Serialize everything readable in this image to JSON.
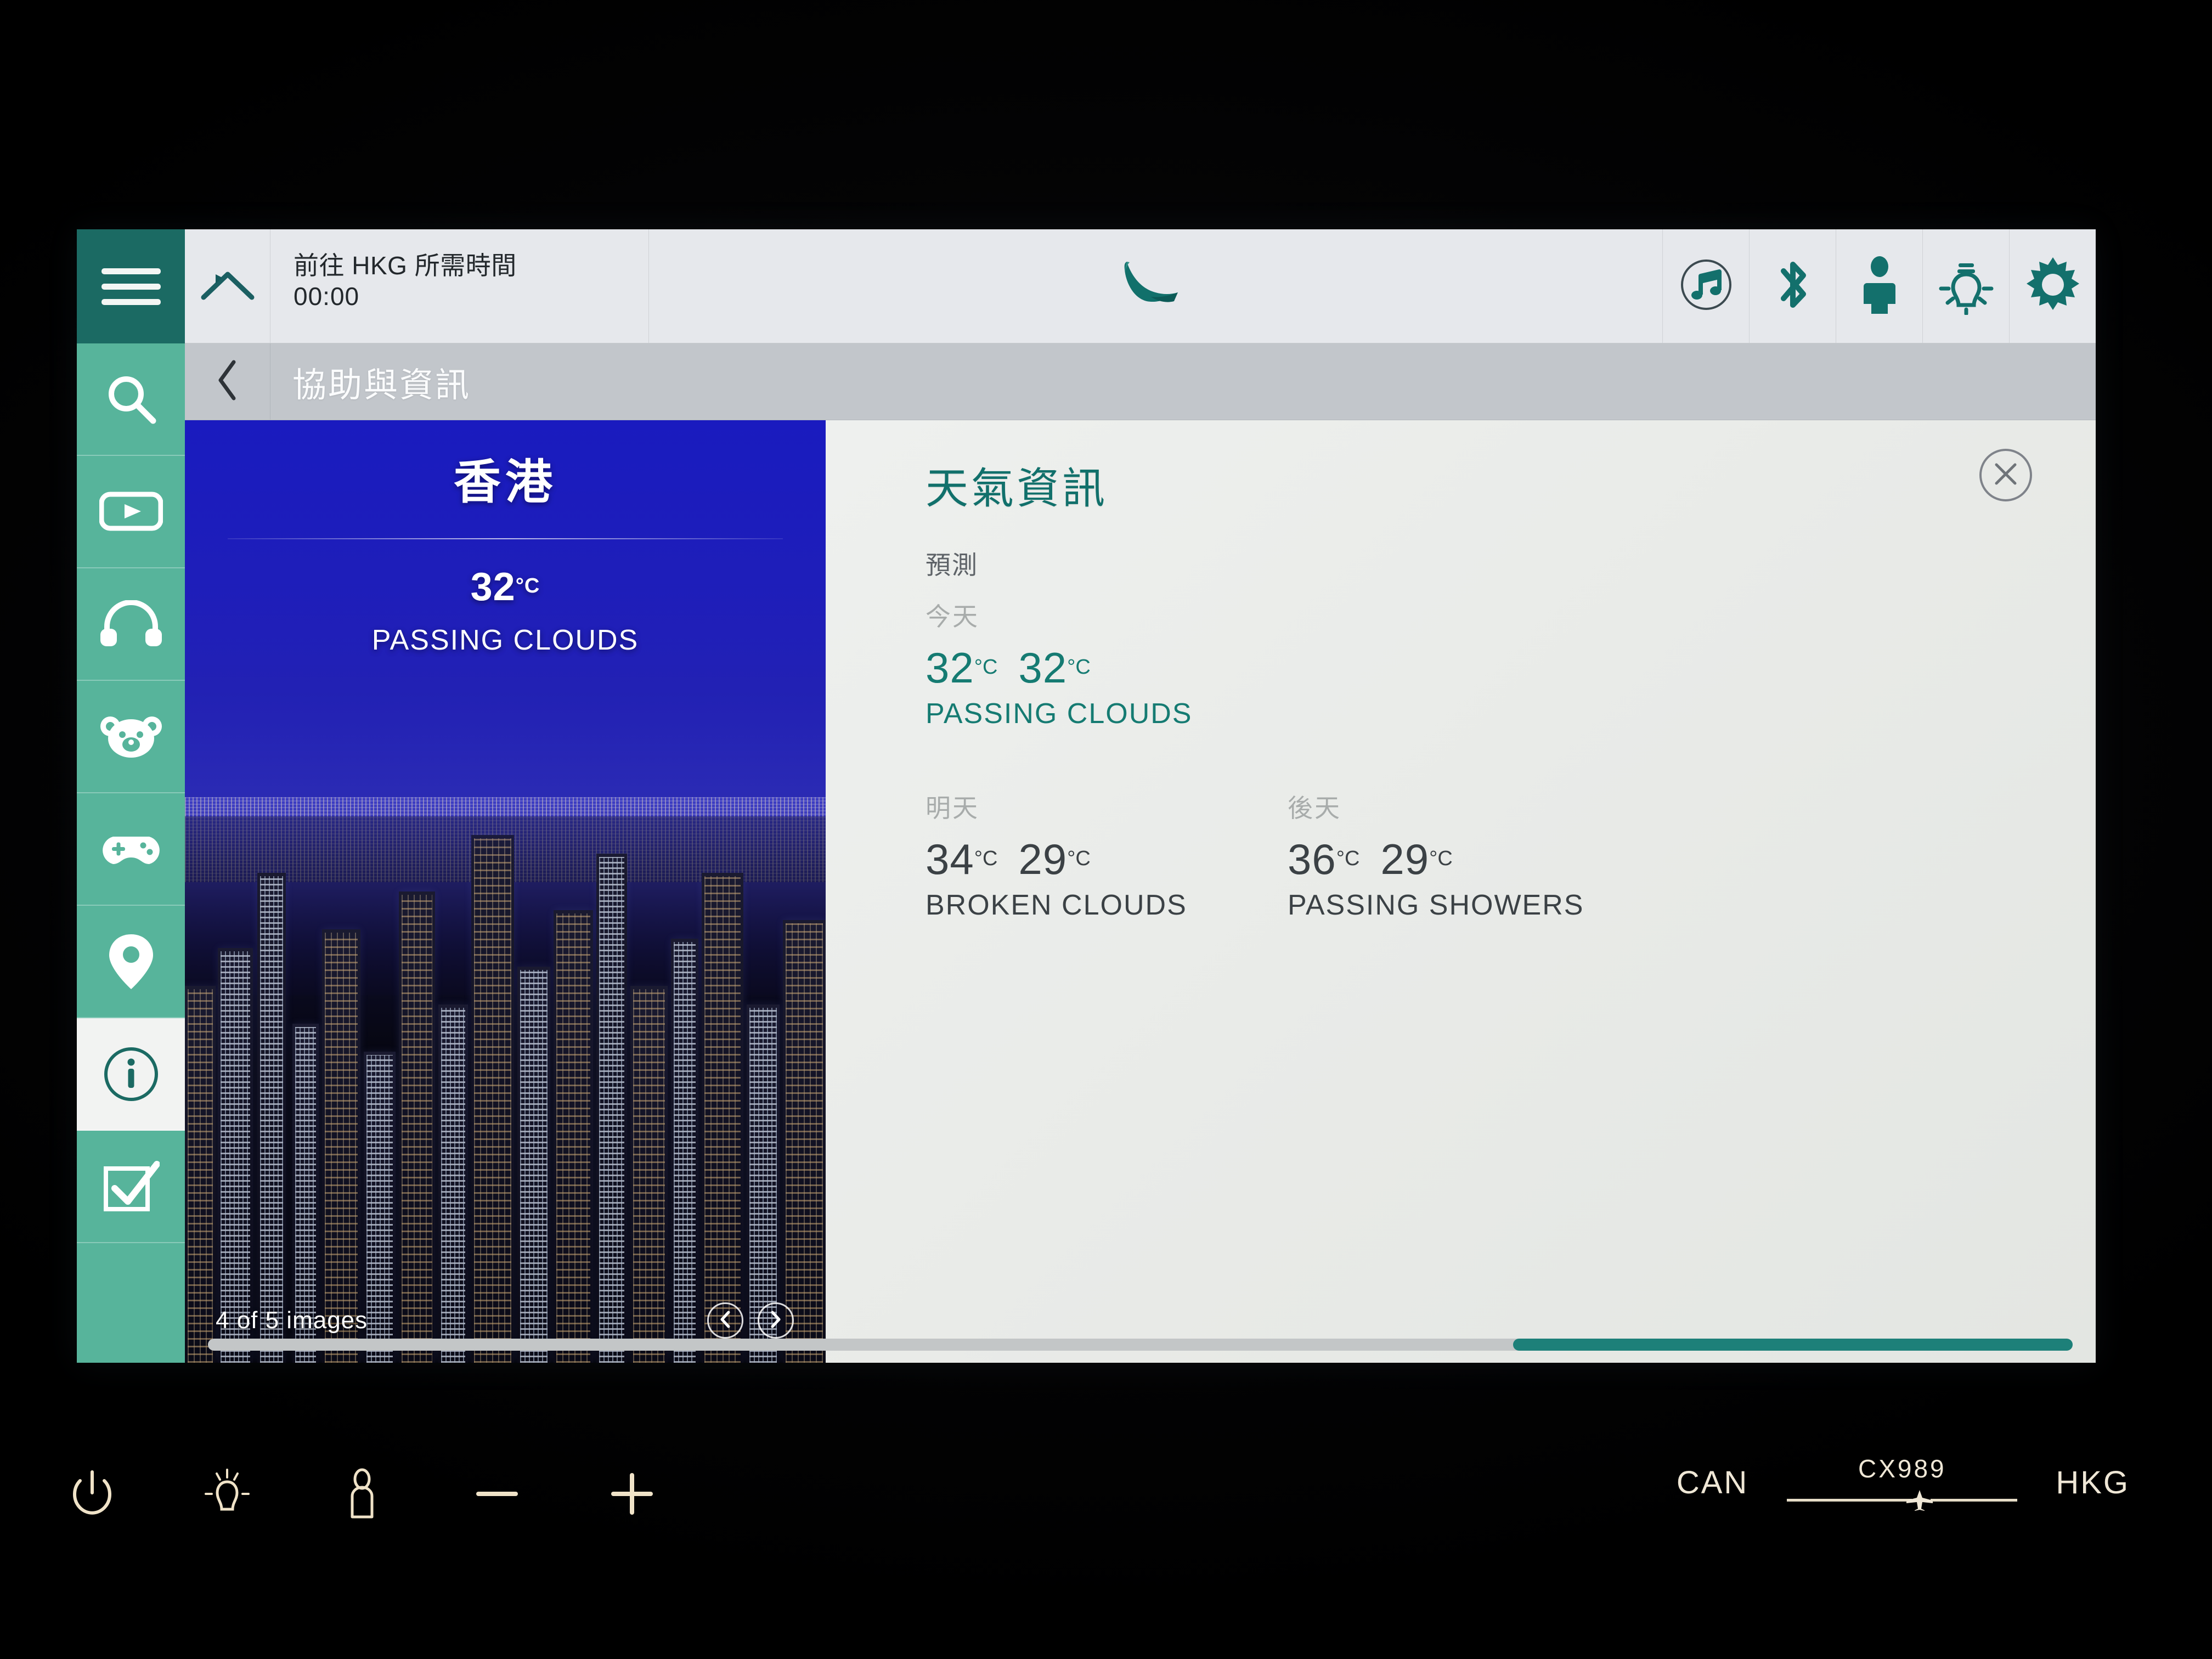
{
  "topbar": {
    "home_icon": "home-chevron-icon",
    "eta_label": "前往 HKG 所需時間",
    "eta_value": "00:00",
    "brand_logo": "cathay-brushwing-logo",
    "icons": [
      {
        "name": "music-note-icon",
        "label": "Audio playing"
      },
      {
        "name": "bluetooth-icon",
        "label": "Bluetooth"
      },
      {
        "name": "attendant-call-icon",
        "label": "Attendant call"
      },
      {
        "name": "reading-light-icon",
        "label": "Reading light"
      },
      {
        "name": "settings-gear-icon",
        "label": "Settings"
      }
    ]
  },
  "page_header": {
    "back_icon": "chevron-left-icon",
    "title": "協助與資訊"
  },
  "sidebar": {
    "items": [
      {
        "name": "menu",
        "icon": "hamburger-menu-icon",
        "active": false
      },
      {
        "name": "search",
        "icon": "search-icon",
        "active": false
      },
      {
        "name": "movies",
        "icon": "play-rectangle-icon",
        "active": false
      },
      {
        "name": "audio",
        "icon": "headphones-icon",
        "active": false
      },
      {
        "name": "kids",
        "icon": "teddy-bear-icon",
        "active": false
      },
      {
        "name": "games",
        "icon": "gamepad-icon",
        "active": false
      },
      {
        "name": "map",
        "icon": "location-pin-icon",
        "active": false
      },
      {
        "name": "info",
        "icon": "info-circle-icon",
        "active": true
      },
      {
        "name": "survey",
        "icon": "checkbox-checked-icon",
        "active": false
      }
    ]
  },
  "hero": {
    "city": "香港",
    "temperature": "32",
    "unit": "°C",
    "condition": "PASSING CLOUDS",
    "image_counter": "4 of  5 images",
    "prev_icon": "chevron-left-circle-icon",
    "next_icon": "chevron-right-circle-icon",
    "image_alt": "hong-kong-night-skyline"
  },
  "weather": {
    "title": "天氣資訊",
    "subtitle": "預測",
    "close_icon": "close-circle-icon",
    "days": [
      {
        "label": "今天",
        "high": "32",
        "low": "32",
        "unit": "°C",
        "condition": "PASSING CLOUDS",
        "is_today": true
      },
      {
        "label": "明天",
        "high": "34",
        "low": "29",
        "unit": "°C",
        "condition": "BROKEN CLOUDS",
        "is_today": false
      },
      {
        "label": "後天",
        "high": "36",
        "low": "29",
        "unit": "°C",
        "condition": "PASSING SHOWERS",
        "is_today": false
      }
    ]
  },
  "scrollbar": {
    "orientation": "horizontal",
    "thumb_position": "right"
  },
  "bezel": {
    "buttons": [
      {
        "name": "power-button",
        "icon": "power-icon"
      },
      {
        "name": "reading-light-button",
        "icon": "reading-light-icon"
      },
      {
        "name": "attendant-call-button",
        "icon": "attendant-call-icon"
      },
      {
        "name": "volume-down-button",
        "icon": "minus-icon"
      },
      {
        "name": "volume-up-button",
        "icon": "plus-icon"
      }
    ],
    "flight": {
      "origin": "CAN",
      "flight_number": "CX989",
      "destination": "HKG",
      "plane_icon": "airplane-icon"
    }
  },
  "colors": {
    "brand_teal": "#11706b",
    "sidebar_green": "#57b49b",
    "sidebar_dark": "#1b6a63",
    "hero_blue": "#2322c6",
    "bezel_amber": "#efe7d6"
  }
}
